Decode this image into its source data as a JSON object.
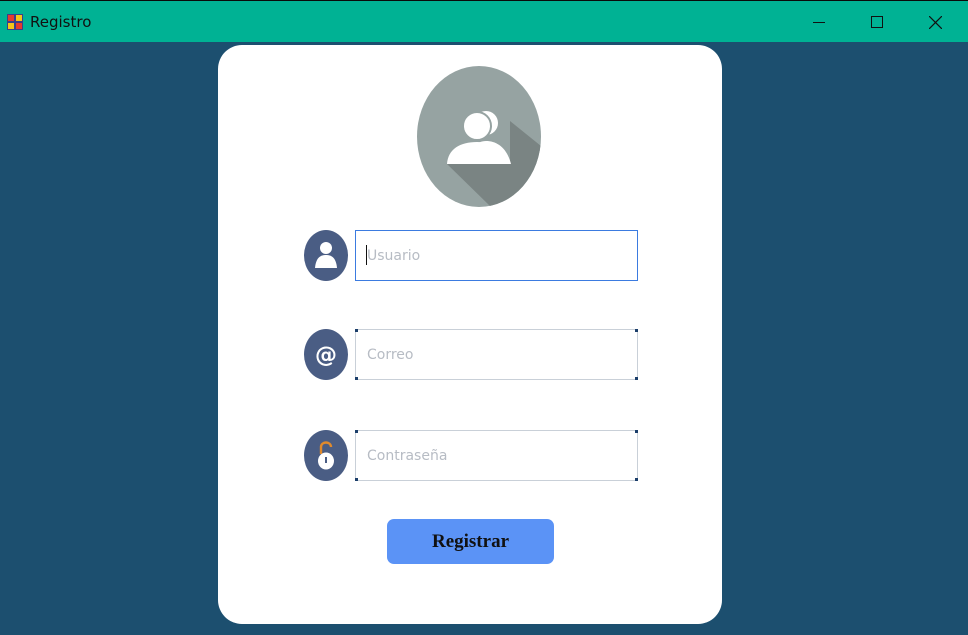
{
  "window": {
    "title": "Registro",
    "minimize_icon": "minimize-icon",
    "maximize_icon": "maximize-icon",
    "close_icon": "close-icon"
  },
  "colors": {
    "titlebar": "#00b294",
    "background": "#1c4f6f",
    "card": "#ffffff",
    "icon_circle": "#4a5d84",
    "avatar": "#96a3a2",
    "button": "#5b93f6"
  },
  "form": {
    "avatar_icon": "users-group-icon",
    "username": {
      "icon": "user-icon",
      "placeholder": "Usuario",
      "value": ""
    },
    "email": {
      "icon": "at-sign-icon",
      "placeholder": "Correo",
      "value": ""
    },
    "password": {
      "icon": "padlock-icon",
      "placeholder": "Contraseña",
      "value": ""
    },
    "submit_label": "Registrar"
  }
}
